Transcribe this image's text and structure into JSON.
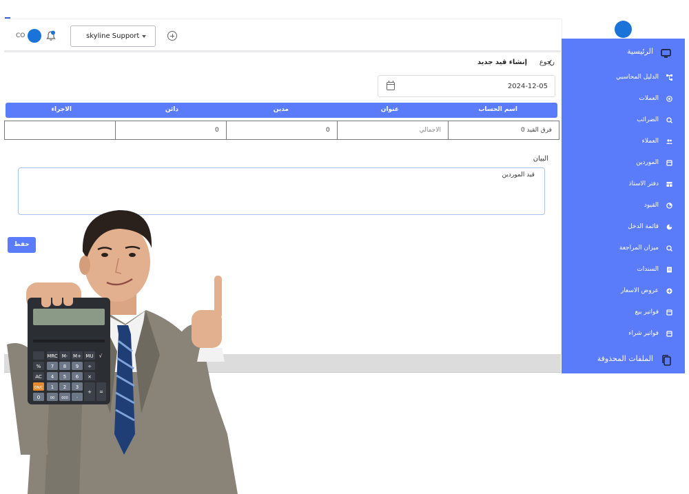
{
  "header": {
    "user_initials": "CO",
    "company_select": "skyline Support"
  },
  "page": {
    "back_label": "رجوع",
    "title": "إنشاء قيد جديد",
    "date_value": "2024-12-05"
  },
  "table": {
    "columns": [
      "اسم الحساب",
      "عنوان",
      "مدين",
      "دائن",
      "الاجراء"
    ],
    "row": {
      "account": "فرق القيد 0",
      "title_placeholder": "الاجمالي",
      "debit": "0",
      "credit": "0",
      "action": ""
    }
  },
  "statement": {
    "label": "البيان",
    "value": "قيد الموردين"
  },
  "save_label": "حفظ",
  "sidebar": {
    "items": [
      {
        "label": "الرئيسية",
        "icon": "monitor-icon"
      },
      {
        "label": "الدليل المحاسبي",
        "icon": "tree-icon"
      },
      {
        "label": "العملات",
        "icon": "currency-icon"
      },
      {
        "label": "الضرائب",
        "icon": "tax-icon"
      },
      {
        "label": "العملاء",
        "icon": "users-icon"
      },
      {
        "label": "الموردين",
        "icon": "supplier-icon"
      },
      {
        "label": "دفتر الاستاذ",
        "icon": "ledger-icon"
      },
      {
        "label": "القيود",
        "icon": "entries-icon"
      },
      {
        "label": "قائمة الدخل",
        "icon": "pie-icon"
      },
      {
        "label": "ميزان المراجعة",
        "icon": "balance-icon"
      },
      {
        "label": "السندات",
        "icon": "document-icon"
      },
      {
        "label": "عروض الاسعار",
        "icon": "quote-icon"
      },
      {
        "label": "فواتير بيع",
        "icon": "invoice-icon"
      },
      {
        "label": "فواتير شراء",
        "icon": "purchase-icon"
      },
      {
        "label": "الملفات المحذوفة",
        "icon": "files-icon"
      }
    ]
  },
  "calculator": {
    "keys_row1": [
      "MRC",
      "M-",
      "M+",
      "MU",
      "√"
    ],
    "keys_row2": [
      "%",
      "7",
      "8",
      "9",
      "÷"
    ],
    "keys_row3": [
      "AC",
      "4",
      "5",
      "6",
      "×"
    ],
    "keys_row4": [
      "ON/C",
      "1",
      "2",
      "3",
      "+"
    ],
    "keys_row5": [
      "0",
      "00",
      "000",
      "·",
      "="
    ]
  }
}
